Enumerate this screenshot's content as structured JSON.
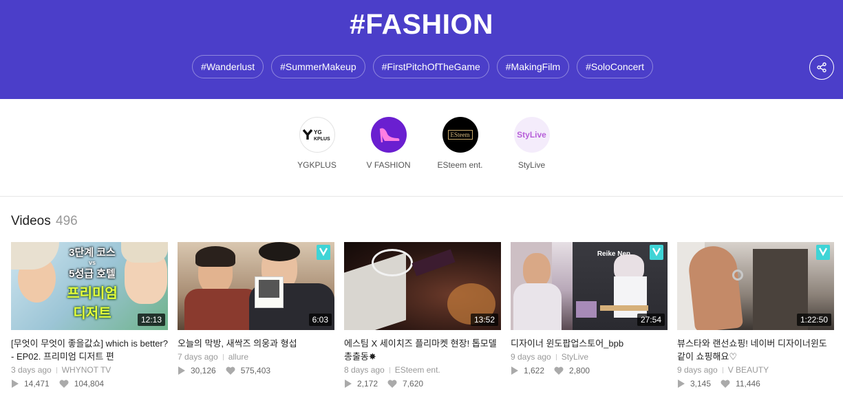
{
  "header": {
    "title": "#FASHION",
    "tags": [
      "#Wanderlust",
      "#SummerMakeup",
      "#FirstPitchOfTheGame",
      "#MakingFilm",
      "#SoloConcert"
    ],
    "share_icon": "share-icon"
  },
  "channels": [
    {
      "name": "YGKPLUS",
      "logo_text": "YG KPLUS"
    },
    {
      "name": "V FASHION",
      "logo_text": ""
    },
    {
      "name": "ESteem ent.",
      "logo_text": "ESteem"
    },
    {
      "name": "StyLive",
      "logo_text": "StyLive"
    }
  ],
  "videos": {
    "label": "Videos",
    "count": "496",
    "items": [
      {
        "duration": "12:13",
        "title": "[무엇이 무엇이 좋을값쇼] which is better? - EP02. 프리미엄 디저트 편",
        "age": "3 days ago",
        "channel": "WHYNOT TV",
        "plays": "14,471",
        "likes": "104,804",
        "thumb_text": [
          "3단계 코스",
          "vs",
          "5성급 호텔",
          "프리미엄",
          "디저트"
        ]
      },
      {
        "duration": "6:03",
        "title": "오늘의 막방, 새싹즈 의웅과 형섭",
        "age": "7 days ago",
        "channel": "allure",
        "plays": "30,126",
        "likes": "575,403"
      },
      {
        "duration": "13:52",
        "title": "에스팀 X 세이치즈 플리마켓 현장! 톱모델 총출동✸",
        "age": "8 days ago",
        "channel": "ESteem ent.",
        "plays": "2,172",
        "likes": "7,620"
      },
      {
        "duration": "27:54",
        "title": "디자이너 윈도팝업스토어_bpb",
        "age": "9 days ago",
        "channel": "StyLive",
        "plays": "1,622",
        "likes": "2,800",
        "thumb_text": [
          "Reike Nen"
        ]
      },
      {
        "duration": "1:22:50",
        "title": "뷰스타와 랜선쇼핑! 네이버 디자이너윈도 같이 쇼핑해요♡",
        "age": "9 days ago",
        "channel": "V BEAUTY",
        "plays": "3,145",
        "likes": "11,446"
      }
    ]
  },
  "colors": {
    "header_bg": "#4b3ec9",
    "vlive_badge": "#3fd4d6"
  }
}
